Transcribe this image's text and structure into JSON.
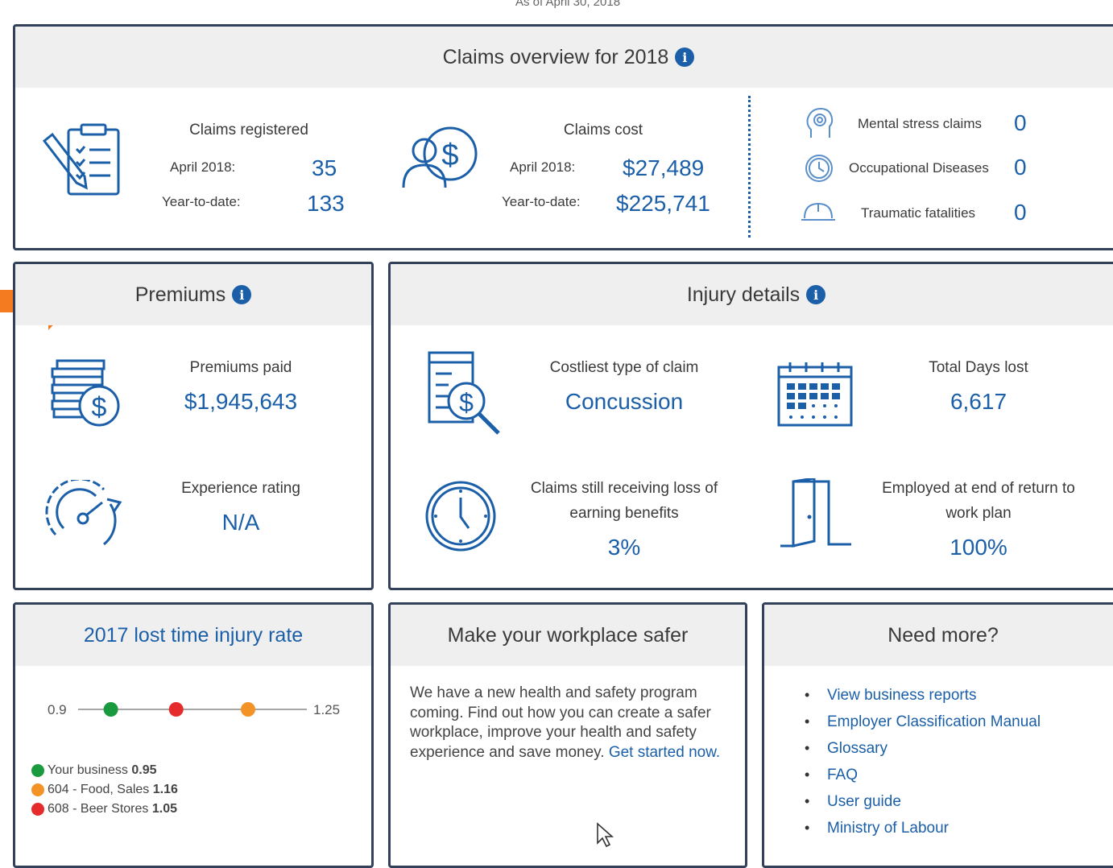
{
  "header": {
    "as_of": "As of April 30, 2018"
  },
  "claims_overview": {
    "title": "Claims overview for 2018",
    "registered": {
      "label": "Claims registered",
      "month_label": "April 2018:",
      "month_value": "35",
      "ytd_label": "Year-to-date:",
      "ytd_value": "133"
    },
    "cost": {
      "label": "Claims cost",
      "month_label": "April 2018:",
      "month_value": "$27,489",
      "ytd_label": "Year-to-date:",
      "ytd_value": "$225,741"
    },
    "side": [
      {
        "label": "Mental stress claims",
        "value": "0"
      },
      {
        "label": "Occupational Diseases",
        "value": "0"
      },
      {
        "label": "Traumatic fatalities",
        "value": "0"
      }
    ]
  },
  "premiums": {
    "title": "Premiums",
    "paid": {
      "label": "Premiums paid",
      "value": "$1,945,643"
    },
    "rating": {
      "label": "Experience rating",
      "value": "N/A"
    }
  },
  "injury": {
    "title": "Injury details",
    "costliest": {
      "label": "Costliest type of claim",
      "value": "Concussion"
    },
    "days_lost": {
      "label": "Total Days lost",
      "value": "6,617"
    },
    "loss_benefits": {
      "label_line1": "Claims still receiving loss of",
      "label_line2": "earning benefits",
      "value": "3%"
    },
    "employed": {
      "label_line1": "Employed at end of return to",
      "label_line2": "work plan",
      "value": "100%"
    }
  },
  "lost_time": {
    "title": "2017 lost time injury rate",
    "scale_min": "0.9",
    "scale_max": "1.25",
    "scale_min_value": 0.9,
    "scale_max_value": 1.25,
    "markers": [
      {
        "value": 0.95,
        "color": "#1a9a3e"
      },
      {
        "value": 1.05,
        "color": "#e52b2b"
      },
      {
        "value": 1.16,
        "color": "#f39325"
      }
    ],
    "legend": [
      {
        "name": "Your business",
        "value": "0.95",
        "color": "#1a9a3e"
      },
      {
        "name": "604 - Food, Sales",
        "value": "1.16",
        "color": "#f39325"
      },
      {
        "name": "608 - Beer Stores",
        "value": "1.05",
        "color": "#e52b2b"
      }
    ]
  },
  "safer": {
    "title": "Make your workplace safer",
    "body": "We have a new health and safety program coming. Find out how you can create a safer workplace, improve your health and safety experience and save money.",
    "link": "Get started now."
  },
  "need_more": {
    "title": "Need more?",
    "links": [
      "View business reports",
      "Employer Classification Manual",
      "Glossary",
      "FAQ",
      "User guide",
      "Ministry of Labour"
    ]
  },
  "colors": {
    "accent": "#1b5fa8",
    "border": "#33405a",
    "arrow": "#f47b20"
  }
}
